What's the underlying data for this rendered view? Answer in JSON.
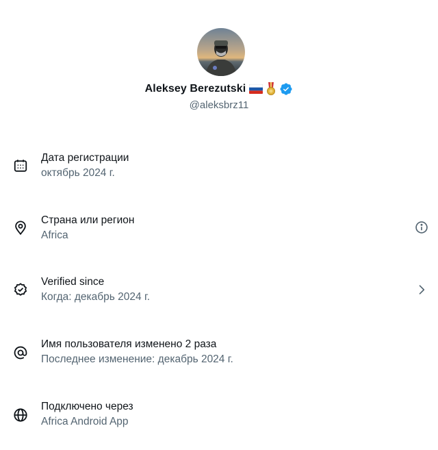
{
  "profile": {
    "name": "Aleksey Berezutski",
    "handle": "@aleksbrz11",
    "avatar_icon": "profile-photo",
    "badges": [
      "russia-flag-emoji",
      "medal-emoji",
      "verified-badge-icon"
    ],
    "verified_color": "#1d9bf0"
  },
  "details": [
    {
      "icon": "calendar-icon",
      "title": "Дата регистрации",
      "subtitle": "октябрь 2024 г."
    },
    {
      "icon": "location-pin-icon",
      "title": "Страна или регион",
      "subtitle": "Africa",
      "action_icon": "info-icon"
    },
    {
      "icon": "verified-check-icon",
      "title": "Verified since",
      "subtitle": "Когда: декабрь 2024 г.",
      "action_icon": "chevron-right-icon"
    },
    {
      "icon": "at-sign-icon",
      "title": "Имя пользователя изменено 2 раза",
      "subtitle": "Последнее изменение: декабрь 2024 г."
    },
    {
      "icon": "globe-icon",
      "title": "Подключено через",
      "subtitle": "Africa Android App"
    }
  ],
  "colors": {
    "text_primary": "#0f1419",
    "text_secondary": "#536471"
  }
}
